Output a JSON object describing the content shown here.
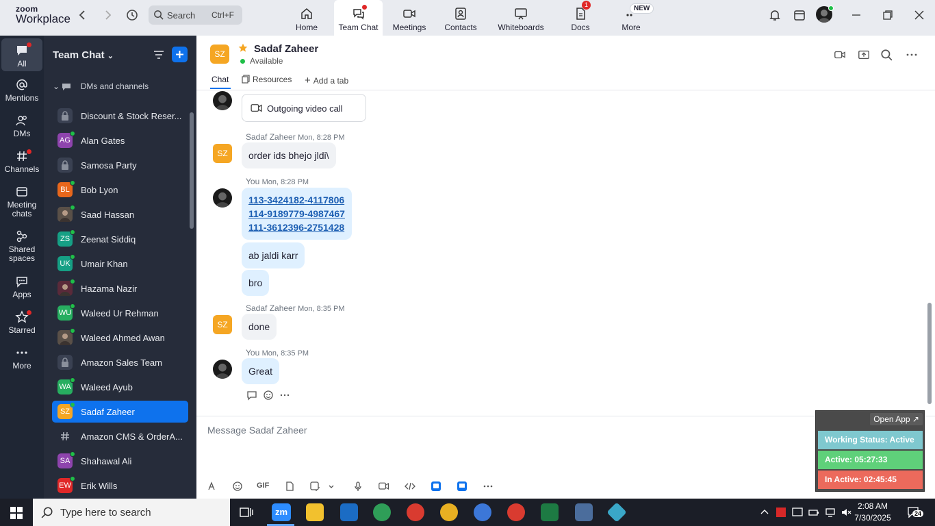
{
  "app": {
    "logo_line1": "zoom",
    "logo_line2": "Workplace"
  },
  "search": {
    "label": "Search",
    "shortcut": "Ctrl+F"
  },
  "top_tabs": [
    {
      "label": "Home",
      "icon": "home-icon"
    },
    {
      "label": "Team Chat",
      "icon": "chat-icon",
      "active": true
    },
    {
      "label": "Meetings",
      "icon": "video-icon"
    },
    {
      "label": "Contacts",
      "icon": "contacts-icon"
    },
    {
      "label": "Whiteboards",
      "icon": "whiteboard-icon"
    },
    {
      "label": "Docs",
      "icon": "docs-icon",
      "badge": "1"
    },
    {
      "label": "More",
      "icon": "more-icon",
      "badge": "NEW"
    }
  ],
  "rail": [
    {
      "label": "All",
      "active": true
    },
    {
      "label": "Mentions"
    },
    {
      "label": "DMs"
    },
    {
      "label": "Channels"
    },
    {
      "label": "Meeting chats"
    },
    {
      "label": "Shared spaces"
    },
    {
      "label": "Apps"
    },
    {
      "label": "Starred"
    },
    {
      "label": "More"
    }
  ],
  "sidebar": {
    "title": "Team Chat",
    "section": "DMs and channels",
    "items": [
      {
        "name": "Discount & Stock Reser...",
        "type": "lock"
      },
      {
        "name": "Alan Gates",
        "initials": "AG",
        "color": "#8e44ad"
      },
      {
        "name": "Samosa Party",
        "type": "lock"
      },
      {
        "name": "Bob Lyon",
        "initials": "BL",
        "color": "#e8671c"
      },
      {
        "name": "Saad Hassan",
        "type": "photo"
      },
      {
        "name": "Zeenat Siddiq",
        "initials": "ZS",
        "color": "#16a085"
      },
      {
        "name": "Umair Khan",
        "initials": "UK",
        "color": "#16a085"
      },
      {
        "name": "Hazama Nazir",
        "type": "photo2"
      },
      {
        "name": "Waleed Ur Rehman",
        "initials": "WU",
        "color": "#27ae60"
      },
      {
        "name": "Waleed Ahmed Awan",
        "type": "photo3"
      },
      {
        "name": "Amazon Sales Team",
        "type": "lock"
      },
      {
        "name": "Waleed Ayub",
        "initials": "WA",
        "color": "#27ae60"
      },
      {
        "name": "Sadaf Zaheer",
        "initials": "SZ",
        "color": "#f5a623",
        "selected": true
      },
      {
        "name": "Amazon CMS & OrderA...",
        "type": "hash"
      },
      {
        "name": "Shahawal Ali",
        "initials": "SA",
        "color": "#8e44ad"
      },
      {
        "name": "Erik Wills",
        "initials": "EW",
        "color": "#e02828"
      }
    ]
  },
  "chat": {
    "contact_initials": "SZ",
    "contact_name": "Sadaf Zaheer",
    "status": "Available",
    "tabs": [
      "Chat",
      "Resources",
      "Add a tab"
    ],
    "call_label": "Outgoing video call",
    "messages": [
      {
        "sender": "Sadaf Zaheer",
        "time": "Mon, 8:28 PM",
        "text": "order ids bhejo jldi\\"
      },
      {
        "sender": "You",
        "time": "Mon, 8:28 PM",
        "links": [
          "113-3424182-4117806",
          "114-9189779-4987467",
          "111-3612396-2751428"
        ],
        "extra": [
          "ab jaldi karr",
          "bro"
        ]
      },
      {
        "sender": "Sadaf Zaheer",
        "time": "Mon, 8:35 PM",
        "text": "done"
      },
      {
        "sender": "You",
        "time": "Mon, 8:35 PM",
        "text": "Great"
      }
    ],
    "composer_placeholder": "Message Sadaf Zaheer",
    "gif_label": "GIF"
  },
  "widget": {
    "open_app": "Open App ↗",
    "working_status": "Working Status: Active",
    "active": "Active: 05:27:33",
    "inactive": "In Active: 02:45:45",
    "colors": {
      "status": "#7fc8cf",
      "active": "#5fd07a",
      "inactive": "#ec6a5c"
    }
  },
  "taskbar": {
    "search_placeholder": "Type here to search",
    "time": "2:08 AM",
    "date": "7/30/2025",
    "notif_count": "24"
  }
}
